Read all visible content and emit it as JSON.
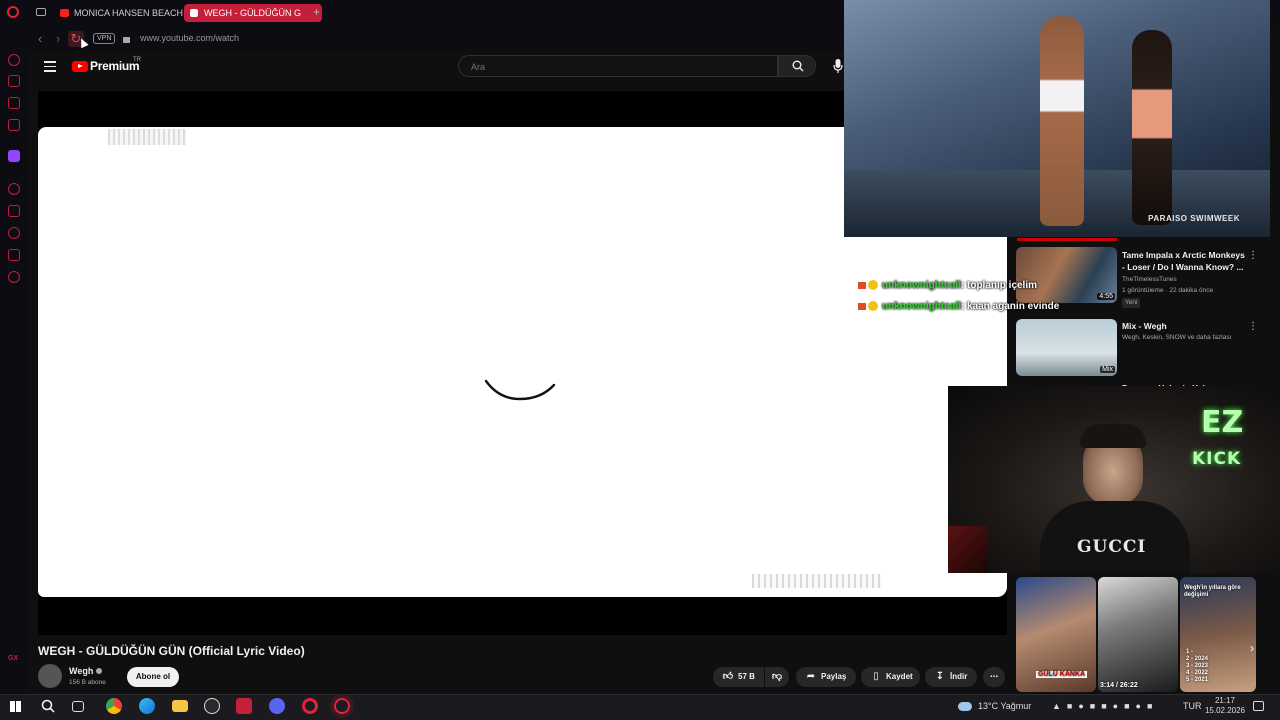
{
  "browser": {
    "tabs": [
      {
        "label": "MONICA HANSEN BEACH",
        "active": false
      },
      {
        "label": "WEGH - GÜLDÜĞÜN G",
        "active": true
      }
    ],
    "new_tab_label": "+",
    "vpn_label": "VPN",
    "url": "www.youtube.com/watch",
    "accent_color": "#c41e3a"
  },
  "youtube": {
    "brand": "Premium",
    "region": "TR",
    "search_placeholder": "Ara",
    "video": {
      "title": "WEGH - GÜLDÜĞÜN GÜN (Official Lyric Video)",
      "channel": "Wegh",
      "subscribers": "156 B abone",
      "subscribe_label": "Abone ol",
      "likes": "57 B",
      "share_label": "Paylaş",
      "save_label": "Kaydet",
      "download_label": "İndir"
    },
    "recommendations": [
      {
        "title": "Tame Impala x Arctic Monkeys - Loser / Do I Wanna Know? ...",
        "channel": "TheTimelessTunes",
        "meta": "1 görüntüleme · 22 dakika önce",
        "badge": "Yeni",
        "duration": "4:55"
      },
      {
        "title": "Mix - Wegh",
        "channel": "Wegh, Keskin, SNOW ve daha fazlası",
        "badge": "Mix"
      },
      {
        "title": "Duman - Haberin Yok Ölüyorum"
      }
    ]
  },
  "pip": {
    "watermark": "PARAISO SWIMWEEK"
  },
  "chat": [
    {
      "user": "unknownightcall",
      "message": ": toplanıp içelim"
    },
    {
      "user": "unknownightcall",
      "message": ": kaan aganin evinde"
    }
  ],
  "webcam": {
    "sign_top": "EZ",
    "sign_bottom": "KICK",
    "shirt_text": "GUCCI"
  },
  "shorts": [
    {
      "caption": "GÜLÜ KANKA"
    },
    {
      "caption": "3:14 / 26:22"
    },
    {
      "caption": "Wegh'in yıllara göre değişimi",
      "list": [
        "1 -",
        "2 - 2024",
        "3 - 2023",
        "4 - 2022",
        "5 - 2021"
      ]
    }
  ],
  "taskbar": {
    "weather": "13°C Yağmur",
    "language": "TUR",
    "time": "21:17",
    "date": "15.02.2026"
  }
}
